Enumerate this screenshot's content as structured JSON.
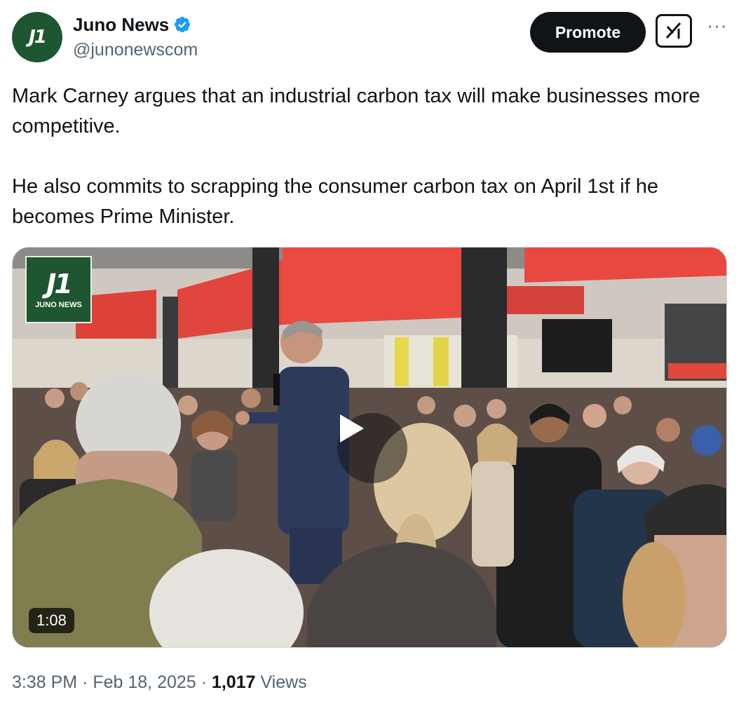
{
  "author": {
    "avatar_text": "J1",
    "name": "Juno News",
    "handle": "@junonewscom",
    "verified": true
  },
  "actions": {
    "promote_label": "Promote",
    "more_label": "···"
  },
  "tweet": {
    "paragraphs": [
      "Mark Carney argues that an industrial carbon tax will make businesses more competitive.",
      "He also commits to scrapping the consumer carbon tax on April 1st if he becomes Prime Minister."
    ]
  },
  "media": {
    "logo_mark": "J1",
    "logo_word": "JUNO NEWS",
    "duration": "1:08"
  },
  "meta": {
    "time": "3:38 PM",
    "date": "Feb 18, 2025",
    "views_count": "1,017",
    "views_label": "Views",
    "separator": "·"
  },
  "colors": {
    "brand_green": "#1e5631",
    "verified_blue": "#1d9bf0",
    "text_primary": "#0f1419",
    "text_secondary": "#536471"
  }
}
